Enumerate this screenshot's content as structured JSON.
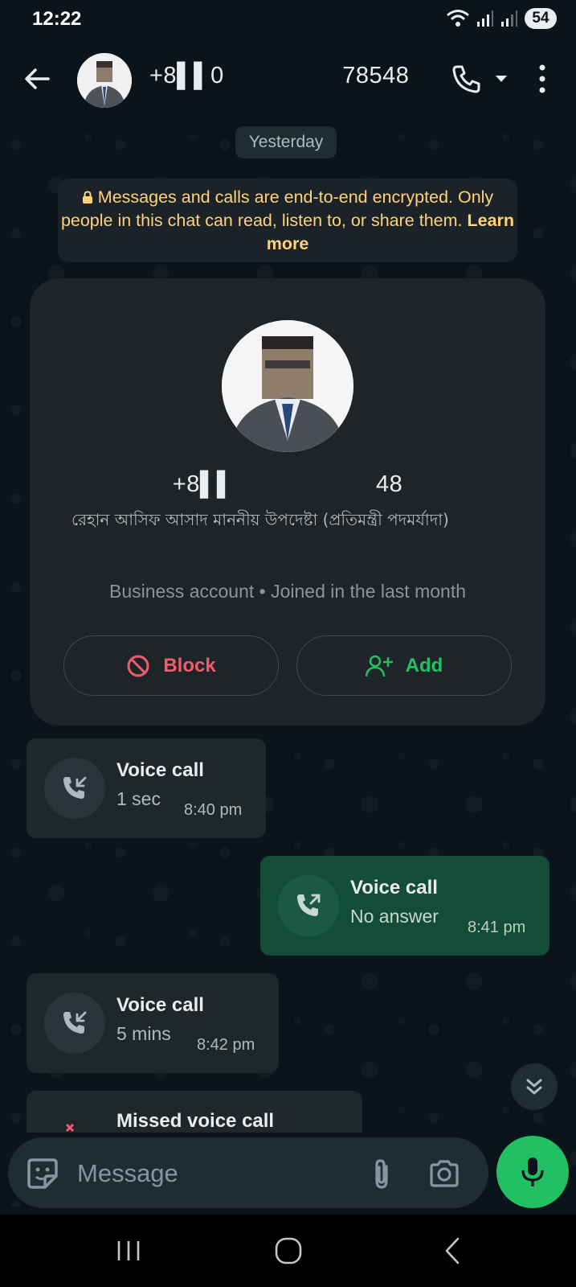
{
  "status_bar": {
    "time": "12:22",
    "battery": "54"
  },
  "header": {
    "title": "+8▌▌0     78548",
    "avatar_icon": "contact-avatar-photo"
  },
  "chat": {
    "date_chip": "Yesterday",
    "encryption_notice": {
      "text": "Messages and calls are end-to-end encrypted. Only people in this chat can read, listen to, or share them.",
      "link": "Learn more"
    },
    "profile_card": {
      "number": "+8▌▌      48",
      "about": "রেহান আসিফ আসাদ মাননীয় উপদেষ্টা (প্রতিমন্ত্রী পদমর্যাদা)",
      "meta": "Business account • Joined in the last month",
      "block_label": "Block",
      "add_label": "Add"
    },
    "messages": [
      {
        "direction": "in",
        "title": "Voice call",
        "subtitle": "1 sec",
        "time": "8:40 pm",
        "icon": "incoming-call-icon"
      },
      {
        "direction": "out",
        "title": "Voice call",
        "subtitle": "No answer",
        "time": "8:41 pm",
        "icon": "outgoing-call-icon"
      },
      {
        "direction": "in",
        "title": "Voice call",
        "subtitle": "5 mins",
        "time": "8:42 pm",
        "icon": "incoming-call-icon"
      },
      {
        "direction": "in",
        "title": "Missed voice call",
        "subtitle": "",
        "time": "",
        "icon": "missed-call-icon"
      }
    ]
  },
  "composer": {
    "placeholder": "Message"
  },
  "colors": {
    "background": "#0b141a",
    "accent_green": "#21c063",
    "danger_red": "#f15c6d",
    "notice_yellow": "#ffd279",
    "outgoing_bubble": "#144d37",
    "incoming_bubble": "#1f272a"
  }
}
